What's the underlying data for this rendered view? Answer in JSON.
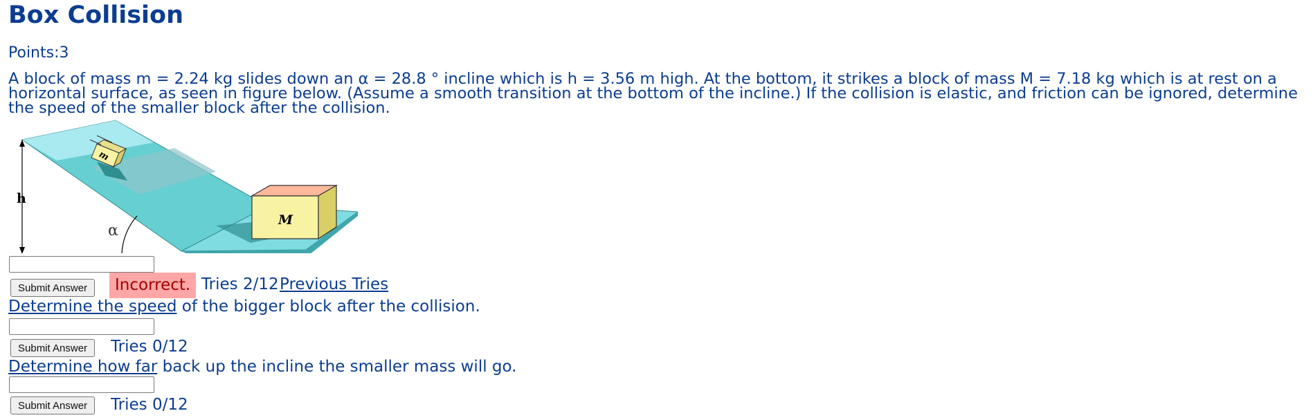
{
  "title": "Box Collision",
  "points": "Points:3",
  "problem_text": "A block of mass m = 2.24 kg slides down an α = 28.8 ° incline which is h = 3.56 m high. At the bottom, it strikes a block of mass M = 7.18 kg which is at rest on a\nhorizontal surface, as seen in figure below. (Assume a smooth transition at the bottom of the incline.) If the collision is elastic, and friction can be ignored, determine\nthe speed of the smaller block after the collision.",
  "figure": {
    "label_h": "h",
    "label_alpha": "α",
    "label_small_block": "m",
    "label_big_block": "M"
  },
  "part1": {
    "input_value": "",
    "submit_label": "Submit Answer",
    "status": "Incorrect.",
    "tries": "Tries 2/12",
    "previous_tries_label": "Previous Tries"
  },
  "part2": {
    "question_link": "Determine the speed",
    "question_rest": " of the bigger block after the collision.",
    "input_value": "",
    "submit_label": "Submit Answer",
    "tries": "Tries 0/12"
  },
  "part3": {
    "question_link": "Determine how far",
    "question_rest": " back up the incline the smaller mass will go.",
    "input_value": "",
    "submit_label": "Submit Answer",
    "tries": "Tries 0/12"
  },
  "colors": {
    "text": "#0b3d91",
    "incorrect_bg": "#ffa6a6",
    "incorrect_text": "#a00000",
    "ramp_light": "#a8eaf0",
    "ramp_mid": "#66cfd2",
    "block_yellow": "#f7f3a3"
  }
}
